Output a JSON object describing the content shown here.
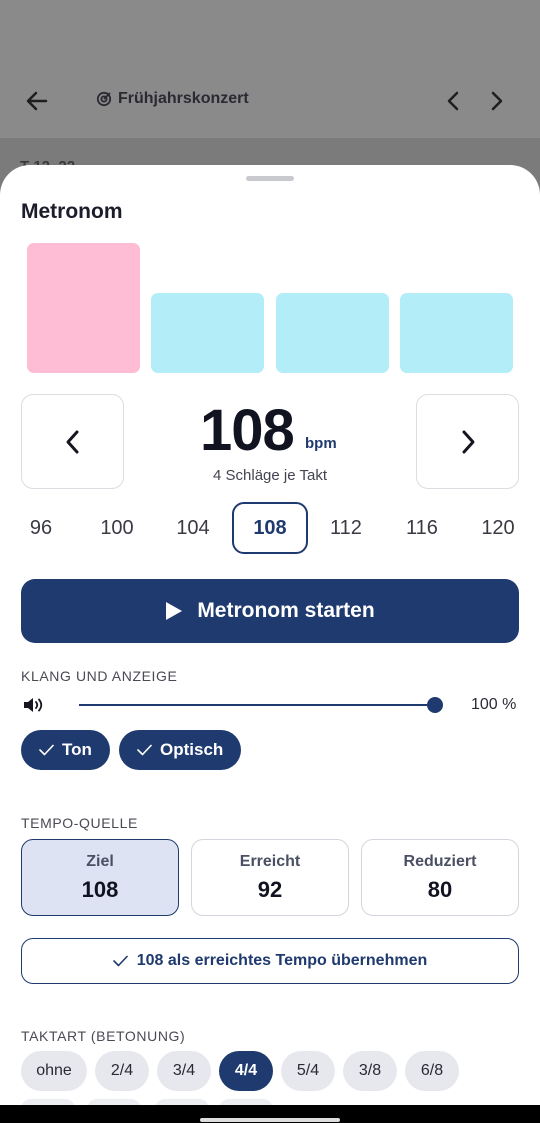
{
  "appbar": {
    "title": "Frühjahrskonzert",
    "behind_text": "T 12–22"
  },
  "sheet": {
    "title": "Metronom"
  },
  "beats": {
    "colors": {
      "accent": "#ffbdd5",
      "normal": "#b3edf7"
    }
  },
  "tempo": {
    "value": "108",
    "unit": "bpm",
    "beats_per_bar": "4 Schläge je Takt",
    "presets": [
      "96",
      "100",
      "104",
      "108",
      "112",
      "116",
      "120"
    ],
    "selected": "108"
  },
  "start_button": {
    "label": "Metronom starten"
  },
  "sound": {
    "section_label": "KLANG UND ANZEIGE",
    "volume": 1.0,
    "volume_label": "100 %",
    "chips": [
      "Ton",
      "Optisch"
    ]
  },
  "tempo_source": {
    "section_label": "TEMPO-QUELLE",
    "cards": [
      {
        "label": "Ziel",
        "value": "108",
        "selected": true
      },
      {
        "label": "Erreicht",
        "value": "92",
        "selected": false
      },
      {
        "label": "Reduziert",
        "value": "80",
        "selected": false
      }
    ],
    "adopt_label": "108 als erreichtes Tempo übernehmen"
  },
  "meter": {
    "section_label": "TAKTART (BETONUNG)",
    "options": [
      "ohne",
      "2/4",
      "3/4",
      "4/4",
      "5/4",
      "3/8",
      "6/8"
    ],
    "selected": "4/4"
  },
  "colors": {
    "primary": "#1f3a6e",
    "selected_bg": "#dde3f2"
  }
}
